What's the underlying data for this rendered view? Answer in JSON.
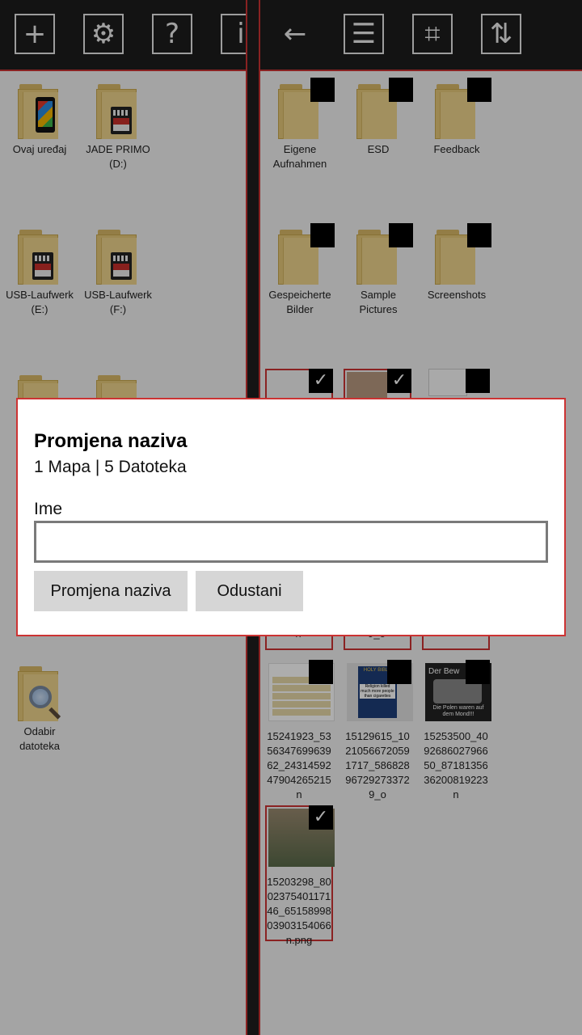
{
  "left_toolbar": {
    "add_glyph": "+",
    "settings_glyph": "⚙",
    "help_glyph": "?",
    "info_glyph": "i"
  },
  "right_toolbar": {
    "back_glyph": "←",
    "list_glyph": "☰",
    "crop_glyph": "⌗",
    "sort_glyph": "⇅"
  },
  "left_pane": {
    "items": [
      {
        "label": "Ovaj uređaj",
        "icon": "phone-folder-icon"
      },
      {
        "label": "JADE PRIMO\n(D:)",
        "icon": "sd-folder-icon"
      },
      {
        "label": "USB-Laufwerk\n(E:)",
        "icon": "sd-folder-icon"
      },
      {
        "label": "USB-Laufwerk\n(F:)",
        "icon": "sd-folder-icon"
      },
      {
        "label": "Odabir\ndatoteka",
        "icon": "search-folder-icon"
      }
    ]
  },
  "right_pane": {
    "folders": [
      {
        "label": "Eigene\nAufnahmen"
      },
      {
        "label": "ESD"
      },
      {
        "label": "Feedback"
      },
      {
        "label": "Gespeicherte\nBilder"
      },
      {
        "label": "Sample\nPictures"
      },
      {
        "label": "Screenshots"
      }
    ],
    "files": [
      {
        "label": "15241923_53\n56347699639\n62_24314592\n47904265215\nn"
      },
      {
        "label": "15129615_10\n21056672059\n1717_586828\n96729273372\n9_o"
      },
      {
        "label": "15253500_40\n92686027966\n50_87181356\n36200819223\nn"
      },
      {
        "label": "15203298_80\n02375401171\n46_65158998\n03903154066\nn.png"
      }
    ],
    "partial_file_labels": [
      "n",
      "9_o",
      ""
    ],
    "check_glyph": "✓"
  },
  "thumbnail_texts": {
    "bible_title": "HOLY BIBLE",
    "bible_caption": "Religion killed much more people than cigarettes",
    "moon_caption_top": "Der Bew",
    "moon_caption_bottom": "Die Polen waren auf dem Mond!!!"
  },
  "dialog": {
    "title": "Promjena naziva",
    "subtitle": "1 Mapa | 5 Datoteka",
    "name_label": "Ime",
    "name_value": "",
    "confirm_label": "Promjena naziva",
    "cancel_label": "Odustani"
  },
  "colors": {
    "accent": "#cc3333",
    "toolbar": "#1c1c1c",
    "pane": "#f2f2f2"
  }
}
